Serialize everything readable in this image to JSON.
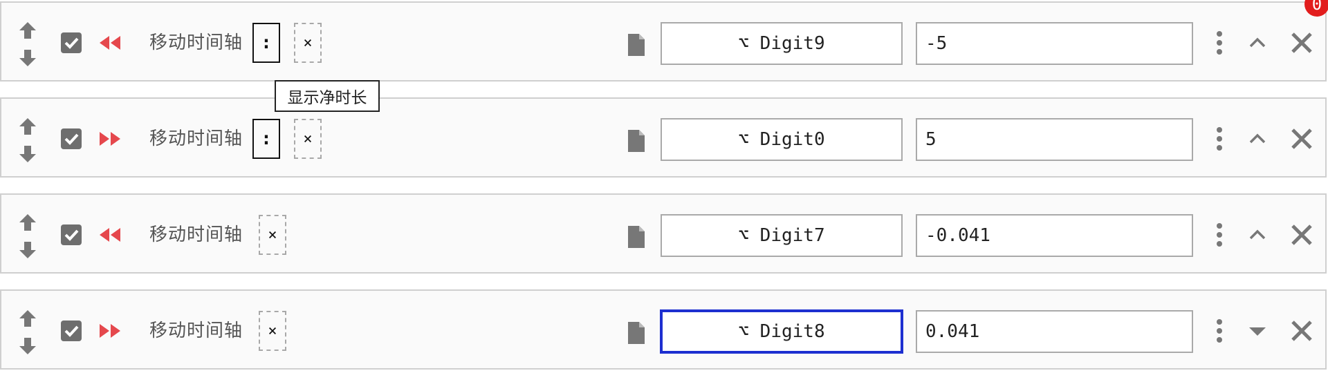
{
  "tooltip": "显示净时长",
  "notification_badge": "0",
  "colors": {
    "accent_red": "#e5484d",
    "icon_grey": "#707070",
    "focus_blue": "#1d2fd0",
    "badge_red": "#e21d1d"
  },
  "rows": [
    {
      "action": "移动时间轴",
      "direction": "rewind",
      "checked": true,
      "show_colon_chip": true,
      "colon_label": ":",
      "clear_label": "×",
      "key": "⌥ Digit9",
      "value": "-5",
      "toggle_icon": "chevron-up"
    },
    {
      "action": "移动时间轴",
      "direction": "forward",
      "checked": true,
      "show_colon_chip": true,
      "colon_label": ":",
      "clear_label": "×",
      "key": "⌥ Digit0",
      "value": "5",
      "toggle_icon": "chevron-up"
    },
    {
      "action": "移动时间轴",
      "direction": "rewind",
      "checked": true,
      "show_colon_chip": false,
      "clear_label": "×",
      "key": "⌥ Digit7",
      "value": "-0.041",
      "toggle_icon": "chevron-up"
    },
    {
      "action": "移动时间轴",
      "direction": "forward",
      "checked": true,
      "show_colon_chip": false,
      "clear_label": "×",
      "key": "⌥ Digit8",
      "value": "0.041",
      "focused_key": true,
      "toggle_icon": "caret-down"
    }
  ]
}
